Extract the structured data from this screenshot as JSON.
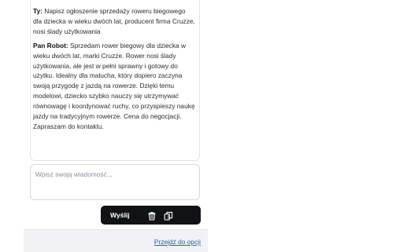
{
  "chat": {
    "messages": [
      {
        "sender": "Ty:",
        "text": "Napisz ogłoszenie sprzedaży roweru biegowego dla dziecka w wieku dwóch lat, producent firma Cruzze, nosi ślady użytkowania"
      },
      {
        "sender": "Pan Robot:",
        "text": "Sprzedam rower biegowy dla dziecka w wieku dwóch lat, marki Cruzze. Rower nosi ślady użytkowania, ale jest w pełni sprawny i gotowy do użytku. Idealny dla malucha, który dopiero zaczyna swoją przygodę z jazdą na rowerze. Dzięki temu modelowi, dziecko szybko nauczy się utrzymywać równowagę i koordynować ruchy, co przyspieszy naukę jazdy na tradycyjnym rowerze. Cena do negocjacji. Zapraszam do kontaktu."
      }
    ]
  },
  "input": {
    "placeholder": "Wpisz swoją wiadomość...",
    "value": ""
  },
  "actions": {
    "send_label": "Wyślij",
    "trash_icon": "trash-icon",
    "copy_icon": "copy-icon"
  },
  "footer": {
    "options_link": "Przejdź do opcji"
  },
  "colors": {
    "action_bar": "#111216",
    "link": "#2a5db8",
    "footer_bg": "#f2f2f4"
  }
}
